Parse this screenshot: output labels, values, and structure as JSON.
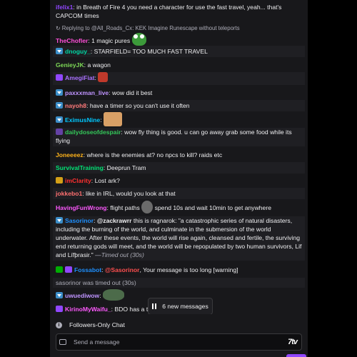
{
  "messages": [
    {
      "user": "ifelix1",
      "color": "#9147ff",
      "text": "in Breath of Fire 4 you need a character for use the fast travel, yeah... that's CAPCOM times"
    },
    {
      "reply_to": "Replying to @All_Roads_Cx: KEK Imagine Runescape without teleports",
      "user": "TheChofler",
      "color": "#ff4fd8",
      "text": "1 magic pures"
    },
    {
      "user": "dnoguy_",
      "color": "#00d6a4",
      "text": "STARFIELD= TOO MUCH FAST TRAVEL"
    },
    {
      "user": "GenieyJK",
      "color": "#7ed957",
      "text": "a wagon"
    },
    {
      "user": "AmegiFiat",
      "color": "#a970ff",
      "text": ""
    },
    {
      "user": "paxxxman_live",
      "color": "#bf94ff",
      "text": "wow did it best"
    },
    {
      "user": "nayoh8",
      "color": "#ff7a7a",
      "text": "have a timer so you can't use it often"
    },
    {
      "user": "EximusNine",
      "color": "#00c8ff",
      "text": ""
    },
    {
      "user": "dailydoseofdespair",
      "color": "#34c759",
      "text": "wow fly thing is good. u can go away grab some food while its flying"
    },
    {
      "user": "Joneeeez",
      "color": "#ffb31a",
      "text": "where is the enemies at? no npcs to kill? raids etc"
    },
    {
      "user": "SurvivalTraining",
      "color": "#00e676",
      "text": "Deeprun Tram"
    },
    {
      "user": "imClarity",
      "color": "#ff3030",
      "text": "Lost ark?"
    },
    {
      "user": "jokkebo1",
      "color": "#ff7070",
      "text": "like in IRL, would you look at that"
    },
    {
      "user": "HavingFunWrong",
      "color": "#ff59ff",
      "text": "flight paths",
      "text2": "spend 10s and wait 10min to get anywhere"
    },
    {
      "user": "Sasorinor",
      "color": "#1e90ff",
      "mention": "@zackrawrr",
      "text": "this is ragnarok: \"a catastrophic series of natural disasters, including the burning of the world, and culminate in the submersion of the world underwater. After these events, the world will rise again, cleansed and fertile, the surviving end returning gods will meet, and the world will be repopulated by two human survivors, Lif and Lífþrasir.\"",
      "timed": "—Timed out (30s)"
    },
    {
      "user": "Fossabot",
      "color": "#1e90ff",
      "mention": "@Sasorinor",
      "mention_color": "#ff4f4f",
      "text": ", Your message is too long [warning]"
    },
    {
      "system": "sasorinor was timed out (30s)"
    },
    {
      "user": "uwuediwow",
      "color": "#bf94ff",
      "text": ""
    },
    {
      "user": "KirinoMyWaifu_",
      "color": "#ff59ff",
      "text": "BDO has a te"
    }
  ],
  "new_messages_pill": "6 new messages",
  "followers_only": "Followers-Only Chat",
  "input_placeholder": "Send a message",
  "logo_text": "7tv",
  "colors": {
    "chat_bg": "#18181b",
    "accent": "#9147ff"
  }
}
